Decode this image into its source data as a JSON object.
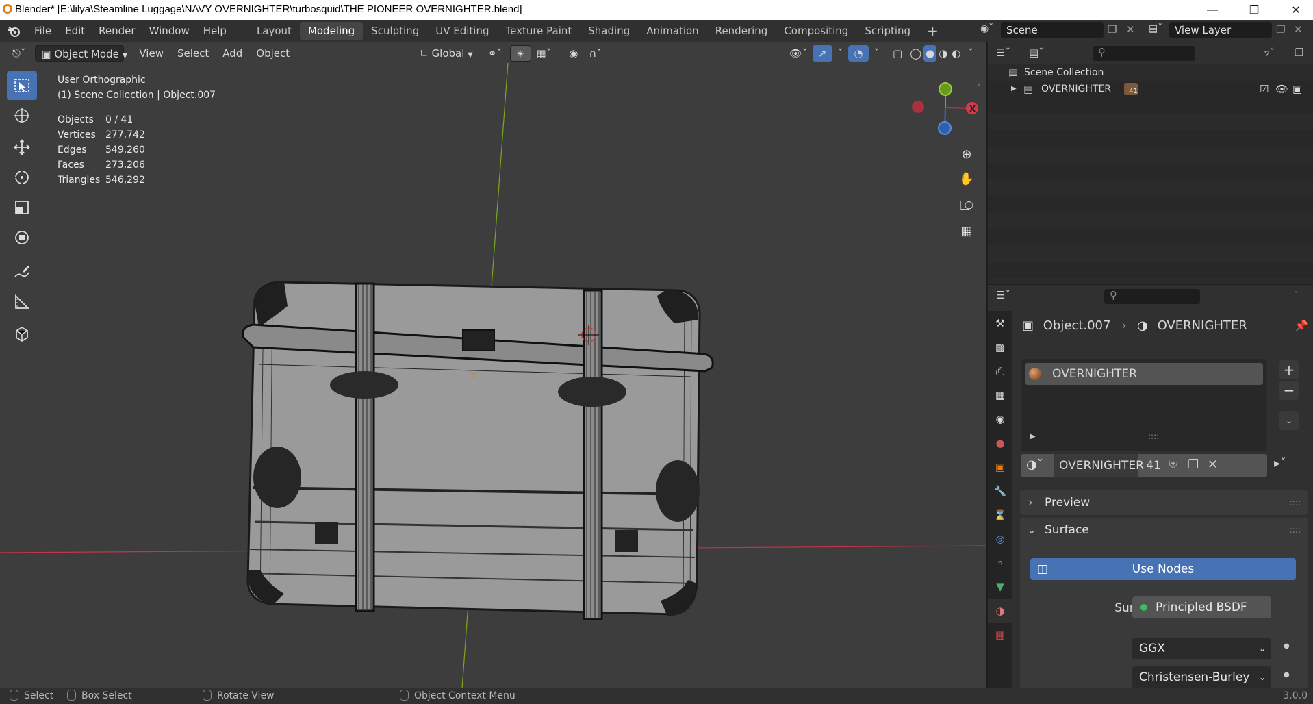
{
  "window": {
    "title": "Blender* [E:\\lilya\\Steamline Luggage\\NAVY OVERNIGHTER\\turbosquid\\THE PIONEER OVERNIGHTER.blend]"
  },
  "menu": [
    "File",
    "Edit",
    "Render",
    "Window",
    "Help"
  ],
  "workspaces": [
    "Layout",
    "Modeling",
    "Sculpting",
    "UV Editing",
    "Texture Paint",
    "Shading",
    "Animation",
    "Rendering",
    "Compositing",
    "Scripting"
  ],
  "active_workspace": "Modeling",
  "scene": {
    "name": "Scene",
    "view_layer": "View Layer"
  },
  "viewport": {
    "mode": "Object Mode",
    "menus": [
      "View",
      "Select",
      "Add",
      "Object"
    ],
    "orientation": "Global",
    "view_name": "User Orthographic",
    "collection_line": "(1) Scene Collection | Object.007",
    "stats": [
      {
        "label": "Objects",
        "value": "0 / 41"
      },
      {
        "label": "Vertices",
        "value": "277,742"
      },
      {
        "label": "Edges",
        "value": "549,260"
      },
      {
        "label": "Faces",
        "value": "273,206"
      },
      {
        "label": "Triangles",
        "value": "546,292"
      }
    ],
    "gizmo": {
      "x": "X"
    }
  },
  "outliner": {
    "root": "Scene Collection",
    "items": [
      {
        "name": "OVERNIGHTER",
        "badge": "41"
      }
    ]
  },
  "properties": {
    "breadcrumb_object": "Object.007",
    "breadcrumb_material": "OVERNIGHTER",
    "slot_name": "OVERNIGHTER",
    "material_name": "OVERNIGHTER",
    "users": "41",
    "panels": {
      "preview": "Preview",
      "surface": "Surface"
    },
    "use_nodes": "Use Nodes",
    "surface_label": "Surface",
    "surface_value": "Principled BSDF",
    "distribution": "GGX",
    "subsurface": "Christensen-Burley"
  },
  "status": {
    "select": "Select",
    "box_select": "Box Select",
    "rotate": "Rotate View",
    "context": "Object Context Menu",
    "version": "3.0.0"
  },
  "colors": {
    "accent": "#4772b3",
    "header": "#303030",
    "viewport_bg": "#3d3d3d",
    "x_axis": "#c6344a",
    "y_axis": "#7da81f"
  }
}
